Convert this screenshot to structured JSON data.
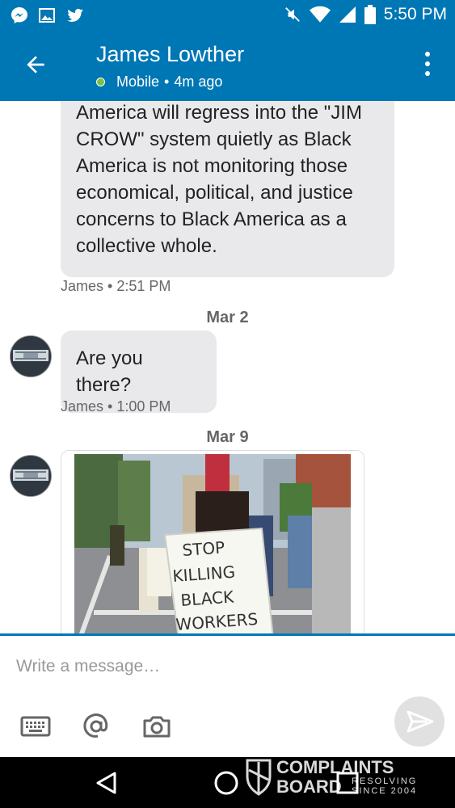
{
  "status_bar": {
    "time": "5:50 PM"
  },
  "header": {
    "title": "James Lowther",
    "presence": "Mobile",
    "separator": "•",
    "last_seen": "4m ago"
  },
  "messages": [
    {
      "text": "America will regress into the \"JIM CROW\" system quietly as Black America is not monitoring those economical,  political, and justice concerns to Black America as a collective whole.",
      "meta": "James • 2:51 PM"
    },
    {
      "date": "Mar 2",
      "text": "Are you there?",
      "meta": "James • 1:00 PM"
    },
    {
      "date": "Mar 9",
      "image": {
        "sign_lines": [
          "STOP",
          "KILLING",
          "BLACK",
          "WORKERS"
        ]
      }
    }
  ],
  "composer": {
    "placeholder": "Write a message…"
  },
  "watermark": {
    "line1": "COMPLAINTS",
    "line2": "BOARD",
    "tag1": "RESOLVING",
    "tag2": "SINCE 2004"
  },
  "colors": {
    "brand": "#0077b5",
    "bubble": "#e9e9ec",
    "online": "#7ac143"
  },
  "icons": [
    "messenger-icon",
    "gallery-icon",
    "twitter-icon",
    "mute-icon",
    "wifi-icon",
    "signal-icon",
    "battery-icon",
    "back-arrow-icon",
    "overflow-menu-icon",
    "keyboard-icon",
    "at-icon",
    "camera-icon",
    "send-icon",
    "nav-back-icon",
    "nav-home-icon",
    "nav-recents-icon"
  ]
}
